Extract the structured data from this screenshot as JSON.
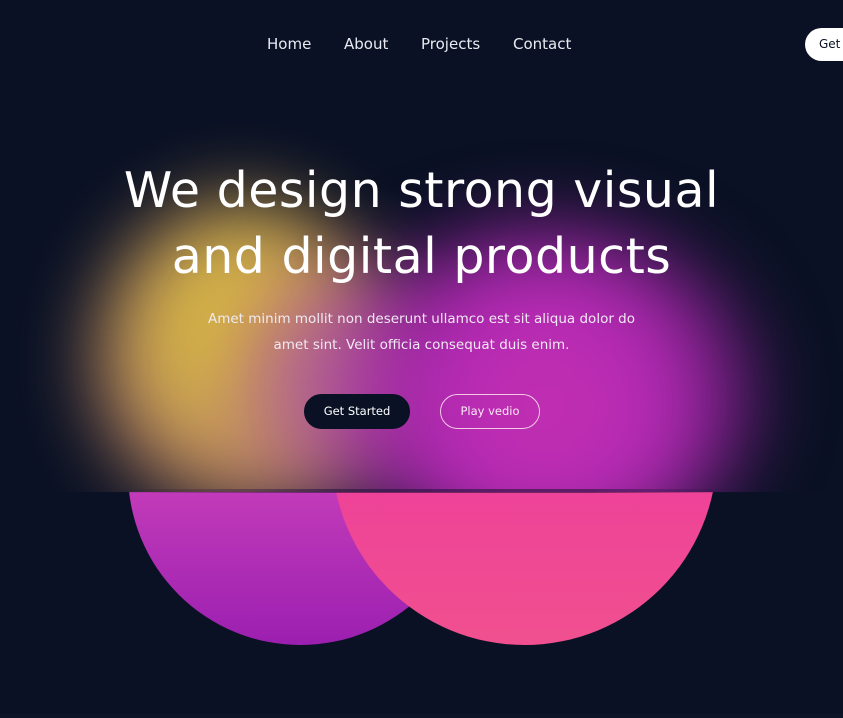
{
  "nav": {
    "items": [
      {
        "label": "Home"
      },
      {
        "label": "About"
      },
      {
        "label": "Projects"
      },
      {
        "label": "Contact"
      }
    ],
    "cta_label": "Get"
  },
  "hero": {
    "title_line1": "We design strong visual",
    "title_line2": "and digital products",
    "subtitle_line1": "Amet minim mollit non deserunt ullamco est sit aliqua dolor do",
    "subtitle_line2": "amet sint. Velit officia consequat duis enim.",
    "primary_button": "Get Started",
    "secondary_button": "Play vedio"
  },
  "colors": {
    "background": "#0a1124",
    "glow_yellow": "#f0d233",
    "glow_magenta": "#b32ab5",
    "circle_left": "#c23bb9",
    "circle_right": "#ee3f9a"
  }
}
